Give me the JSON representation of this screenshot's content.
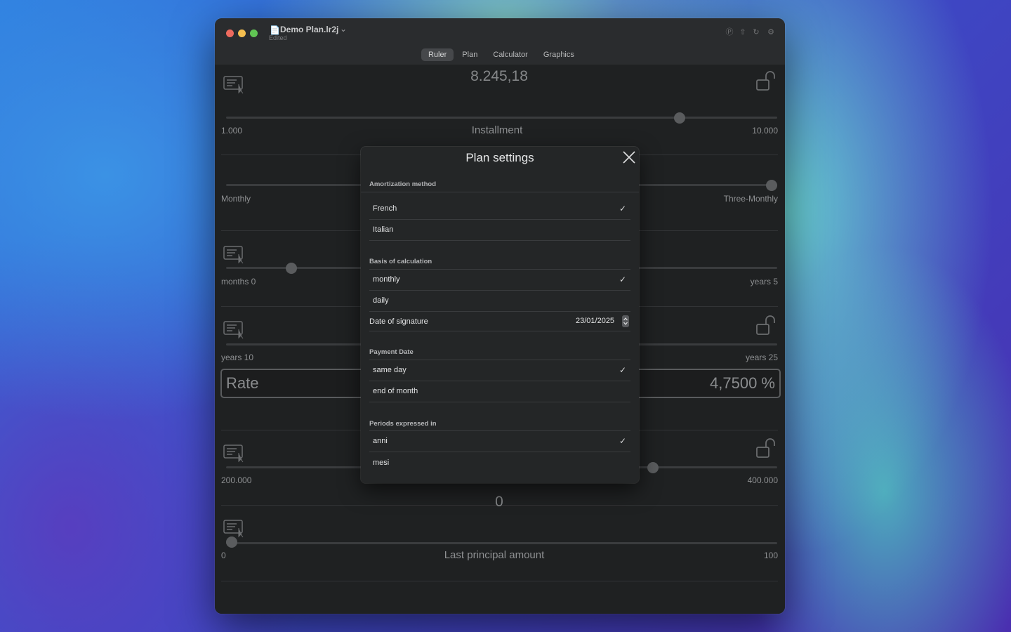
{
  "window": {
    "title": "Demo Plan.lr2j",
    "subtitle": "Edited",
    "traffic_lights": {
      "close": "#ed6a5e",
      "minimize": "#f5bf4f",
      "zoom": "#61c554"
    }
  },
  "tabs": [
    "Ruler",
    "Plan",
    "Calculator",
    "Graphics"
  ],
  "active_tab": "Ruler",
  "rows": {
    "installment": {
      "value": "8.245,18",
      "label": "Installment",
      "min": "1.000",
      "max": "10.000",
      "level": 0.83
    },
    "frequency": {
      "min": "Monthly",
      "max": "Three-Monthly",
      "level": 1.0
    },
    "preamortization": {
      "min": "months 0",
      "max": "years 5",
      "level": 0.11
    },
    "duration": {
      "min": "years 10",
      "max": "years 25"
    },
    "rate": {
      "label": "Rate",
      "value": "4,7500 %"
    },
    "amount": {
      "min": "200.000",
      "max": "400.000",
      "level": 0.78
    },
    "last_principal": {
      "value": "0",
      "label": "Last principal amount",
      "min": "0",
      "max": "100",
      "level": 0.0
    }
  },
  "dialog": {
    "title": "Plan settings",
    "sections": {
      "amortization": {
        "header": "Amortization method",
        "options": [
          "French",
          "Italian"
        ],
        "selected": "French"
      },
      "basis": {
        "header": "Basis of calculation",
        "options": [
          "monthly",
          "daily"
        ],
        "selected": "monthly"
      },
      "payment": {
        "header": "Payment Date",
        "options": [
          "same day",
          "end of month"
        ],
        "selected": "same day"
      },
      "periods": {
        "header": "Periods expressed in",
        "options": [
          "anni",
          "mesi"
        ],
        "selected": "anni"
      }
    },
    "date_of_signature": {
      "label": "Date of signature",
      "value": "23/01/2025"
    },
    "check_glyph": "✓"
  }
}
